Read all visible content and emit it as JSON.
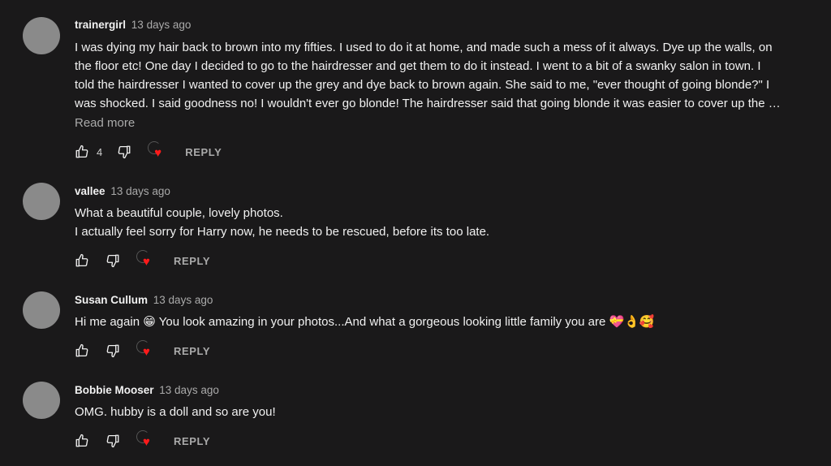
{
  "comments": [
    {
      "author": "trainergirl",
      "time": "13 days ago",
      "lines": [
        "I was dying my hair back to brown into my fifties.  I used to do it at home, and made such a mess of it always. Dye up the walls, on",
        "the floor etc!  One day I decided to go to the hairdresser and get them to do it instead.  I went to a  bit of a swanky salon in town. I",
        "told the hairdresser I wanted to cover up the grey and dye back to brown again.  She said to me, \"ever thought of going blonde?\"  I",
        "was shocked. I said goodness no!  I wouldn't ever go blonde!  The hairdresser said that going blonde it was easier to cover up the …"
      ],
      "read_more": "Read more",
      "likes": "4",
      "reply": "REPLY"
    },
    {
      "author": "vallee",
      "time": "13 days ago",
      "lines": [
        "What a beautiful couple, lovely photos.",
        "I actually feel sorry for Harry now, he needs to be rescued, before its too late."
      ],
      "reply": "REPLY"
    },
    {
      "author": "Susan Cullum",
      "time": "13 days ago",
      "text_before": "Hi me again ",
      "emoji1": "😁",
      "text_after": " You look amazing in your photos...And what a gorgeous looking little family you are ",
      "emoji_tail": "💝👌🥰",
      "reply": "REPLY"
    },
    {
      "author": "Bobbie Mooser",
      "time": "13 days ago",
      "lines": [
        "OMG. hubby is a doll and so are you!"
      ],
      "reply": "REPLY"
    }
  ],
  "icons": {
    "like": "thumbs-up-icon",
    "dislike": "thumbs-down-icon",
    "creator_heart": "heart-icon"
  },
  "colors": {
    "background": "#1a191a",
    "heart": "#ff1a1a",
    "avatar": "#8a8a8a"
  }
}
